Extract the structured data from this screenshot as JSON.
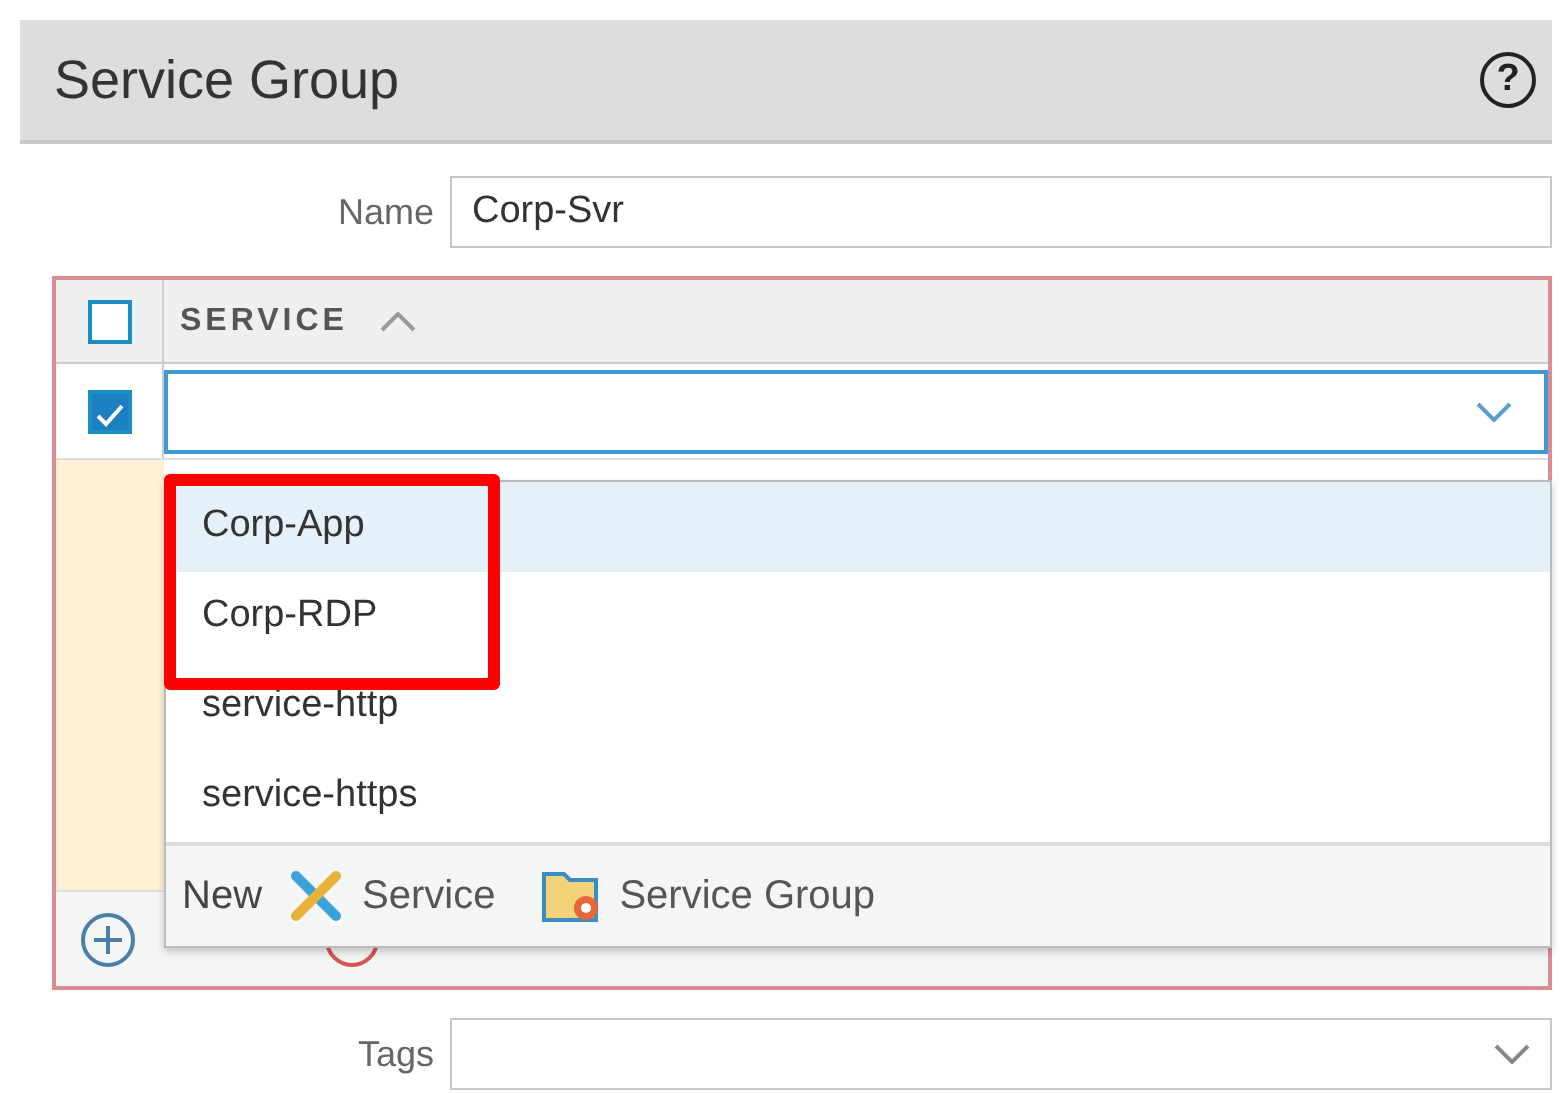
{
  "dialog": {
    "title": "Service Group",
    "help": "?"
  },
  "name_field": {
    "label": "Name",
    "value": "Corp-Svr"
  },
  "table": {
    "header_checked": false,
    "column": "SERVICE",
    "sort_ascending": true,
    "rows": [
      {
        "checked": true,
        "expanded": true
      }
    ]
  },
  "dropdown": {
    "items": [
      {
        "label": "Corp-App",
        "selected": true
      },
      {
        "label": "Corp-RDP",
        "selected": false
      },
      {
        "label": "service-http",
        "selected": false
      },
      {
        "label": "service-https",
        "selected": false
      }
    ],
    "footer_label": "New",
    "actions": [
      {
        "label": "Service",
        "kind": "service"
      },
      {
        "label": "Service Group",
        "kind": "group"
      }
    ]
  },
  "tags_field": {
    "label": "Tags"
  }
}
